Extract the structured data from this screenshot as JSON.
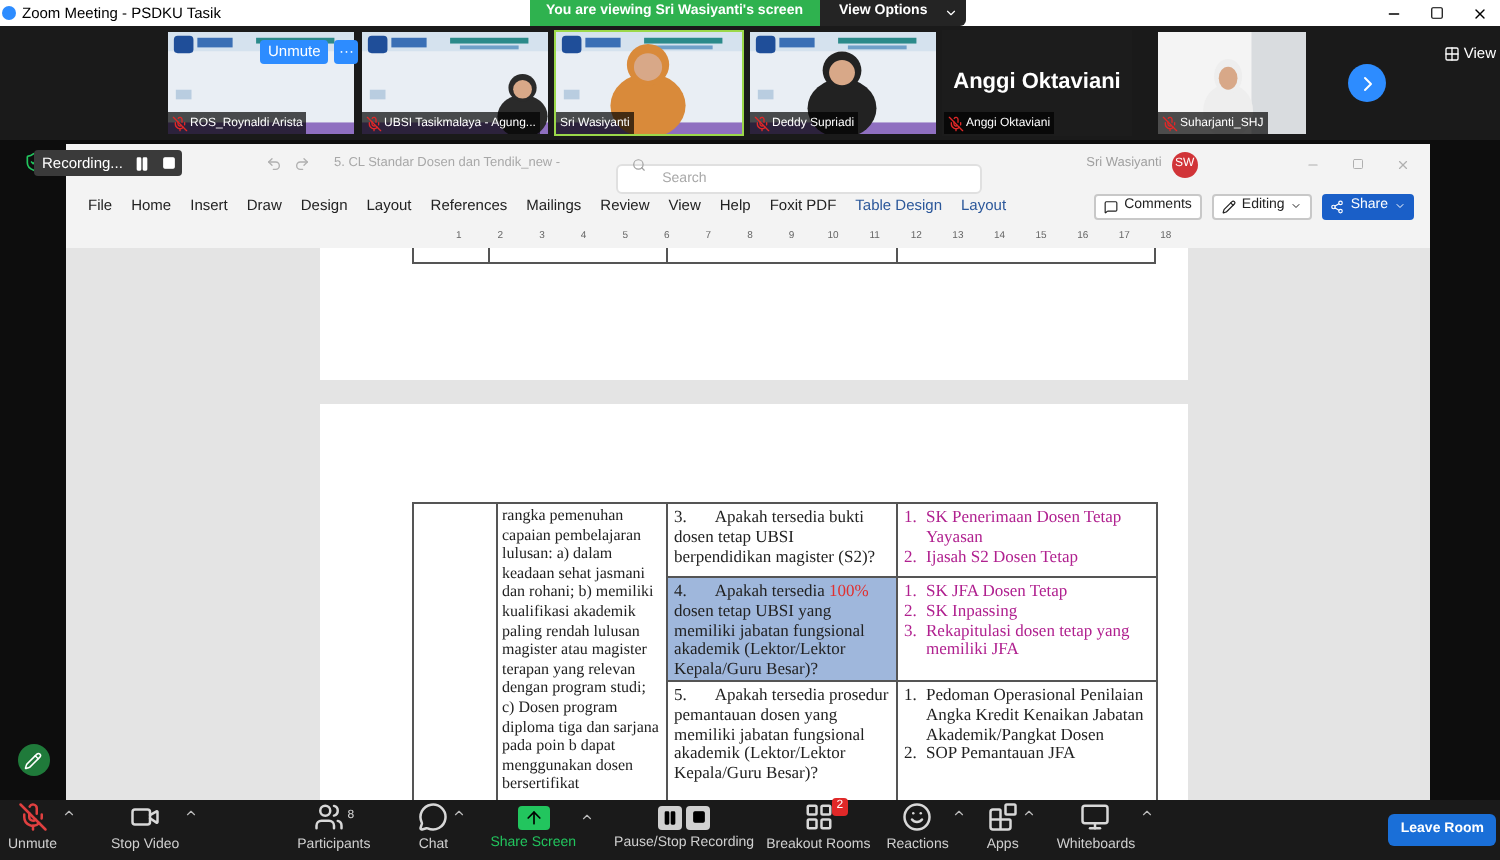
{
  "window": {
    "title": "Zoom Meeting - PSDKU Tasik"
  },
  "share_banner": {
    "text": "You are viewing Sri Wasiyanti's screen",
    "view_options": "View Options"
  },
  "gallery": [
    {
      "kind": "video",
      "name": "ROS_Roynaldi Arista",
      "muted": true,
      "speaking": false,
      "hover": {
        "unmute": "Unmute",
        "more": "···"
      }
    },
    {
      "kind": "video",
      "name": "UBSI Tasikmalaya - Agung...",
      "muted": true,
      "speaking": false
    },
    {
      "kind": "video",
      "name": "Sri Wasiyanti",
      "muted": false,
      "speaking": true
    },
    {
      "kind": "video",
      "name": "Deddy Supriadi",
      "muted": true,
      "speaking": false
    },
    {
      "kind": "name",
      "display": "Anggi Oktaviani",
      "name": "Anggi Oktaviani",
      "muted": true,
      "speaking": false
    },
    {
      "kind": "video",
      "name": "Suharjanti_SHJ",
      "muted": true,
      "speaking": false
    }
  ],
  "view_label": "View",
  "recording": {
    "label": "Recording..."
  },
  "word": {
    "doc_title": "5. CL Standar Dosen dan Tendik_new  -",
    "search_placeholder": "Search",
    "user": "Sri Wasiyanti",
    "initials": "SW",
    "tabs": [
      {
        "label": "File",
        "kind": "normal"
      },
      {
        "label": "Home",
        "kind": "normal"
      },
      {
        "label": "Insert",
        "kind": "normal"
      },
      {
        "label": "Draw",
        "kind": "normal"
      },
      {
        "label": "Design",
        "kind": "normal"
      },
      {
        "label": "Layout",
        "kind": "normal"
      },
      {
        "label": "References",
        "kind": "normal"
      },
      {
        "label": "Mailings",
        "kind": "normal"
      },
      {
        "label": "Review",
        "kind": "normal"
      },
      {
        "label": "View",
        "kind": "normal"
      },
      {
        "label": "Help",
        "kind": "normal"
      },
      {
        "label": "Foxit PDF",
        "kind": "normal"
      },
      {
        "label": "Table Design",
        "kind": "contextual"
      },
      {
        "label": "Layout",
        "kind": "contextual"
      }
    ],
    "comments": "Comments",
    "editing": "Editing",
    "share": "Share",
    "ruler": [
      "1",
      "2",
      "3",
      "4",
      "5",
      "6",
      "7",
      "8",
      "9",
      "10",
      "11",
      "12",
      "13",
      "14",
      "15",
      "16",
      "17",
      "18"
    ],
    "table": {
      "standard_text": "rangka pemenuhan capaian pembelajaran lulusan: a) dalam keadaan sehat jasmani dan rohani; b) memiliki kualifikasi akademik paling rendah lulusan magister atau magister terapan yang relevan dengan program studi; c) Dosen program diploma tiga dan sarjana pada poin b dapat menggunakan dosen bersertifikat",
      "rows": [
        {
          "number": "3.",
          "question": "Apakah tersedia bukti dosen tetap UBSI berpendidikan magister (S2)?",
          "highlighted": false,
          "evidence": [
            {
              "number": "1.",
              "text": "SK Penerimaan Dosen Tetap Yayasan",
              "color": "#b0208f"
            },
            {
              "number": "2.",
              "text": "Ijasah S2 Dosen Tetap",
              "color": "#b0208f"
            }
          ]
        },
        {
          "number": "4.",
          "question": "Apakah tersedia",
          "emphasis": "100%",
          "question_rest": "dosen tetap UBSI yang memiliki jabatan fungsional akademik  (Lektor/Lektor Kepala/Guru Besar)?",
          "highlighted": true,
          "evidence": [
            {
              "number": "1.",
              "text": "SK JFA Dosen Tetap",
              "color": "#b0208f"
            },
            {
              "number": "2.",
              "text": "SK Inpassing",
              "color": "#b0208f"
            },
            {
              "number": "3.",
              "text": "Rekapitulasi dosen tetap yang memiliki JFA",
              "color": "#b0208f"
            }
          ]
        },
        {
          "number": "5.",
          "question": "Apakah tersedia prosedur pemantauan dosen yang memiliki jabatan fungsional akademik  (Lektor/Lektor Kepala/Guru Besar)?",
          "highlighted": false,
          "evidence": [
            {
              "number": "1.",
              "text": "Pedoman Operasional Penilaian Angka Kredit Kenaikan Jabatan Akademik/Pangkat Dosen",
              "color": "#222222"
            },
            {
              "number": "2.",
              "text": "SOP Pemantauan JFA",
              "color": "#222222"
            }
          ]
        }
      ]
    }
  },
  "toolbar": [
    {
      "kind": "mic",
      "label": "Unmute",
      "caret": true
    },
    {
      "kind": "video",
      "label": "Stop Video",
      "caret": true
    },
    {
      "kind": "participants",
      "label": "Participants",
      "count": "8",
      "caret": false
    },
    {
      "kind": "chat",
      "label": "Chat",
      "caret": true
    },
    {
      "kind": "share",
      "label": "Share Screen",
      "caret": true
    },
    {
      "kind": "recording",
      "label": "Pause/Stop Recording",
      "caret": false
    },
    {
      "kind": "breakout",
      "label": "Breakout Rooms",
      "badge": "2",
      "caret": false
    },
    {
      "kind": "reactions",
      "label": "Reactions",
      "caret": true
    },
    {
      "kind": "apps",
      "label": "Apps",
      "caret": true
    },
    {
      "kind": "whiteboards",
      "label": "Whiteboards",
      "caret": true
    }
  ],
  "leave": "Leave Room"
}
